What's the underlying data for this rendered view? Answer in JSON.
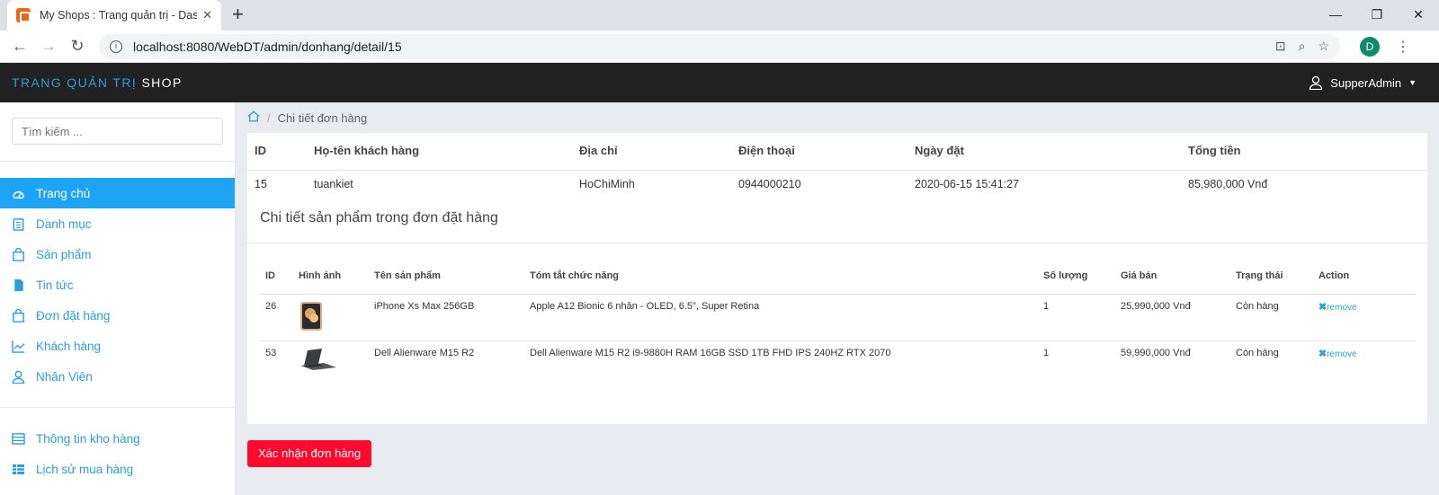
{
  "browser": {
    "tab_title": "My Shops : Trang quản trị - Dashboard",
    "url": "localhost:8080/WebDT/admin/donhang/detail/15",
    "profile_initial": "D"
  },
  "navbar": {
    "brand_main": "TRANG QUẢN TRỊ",
    "brand_suffix": "SHOP",
    "user_name": "SupperAdmin"
  },
  "sidebar": {
    "search_placeholder": "Tìm kiếm ...",
    "items": [
      {
        "label": "Trang chủ",
        "icon": "dashboard-icon",
        "active": true
      },
      {
        "label": "Danh mục",
        "icon": "clipboard-icon"
      },
      {
        "label": "Sản phẩm",
        "icon": "shopping-bag-icon"
      },
      {
        "label": "Tin tức",
        "icon": "document-icon"
      },
      {
        "label": "Đơn đặt hàng",
        "icon": "shopping-bag-icon"
      },
      {
        "label": "Khách hàng",
        "icon": "line-chart-icon"
      },
      {
        "label": "Nhân Viên",
        "icon": "user-icon"
      }
    ],
    "extra_items": [
      {
        "label": "Thông tin kho hàng",
        "icon": "table-icon"
      },
      {
        "label": "Lịch sử mua hàng",
        "icon": "grid-icon"
      }
    ]
  },
  "breadcrumb": {
    "current": "Chi tiết đơn hàng"
  },
  "order": {
    "headers": [
      "ID",
      "Họ-tên khách hàng",
      "Địa chỉ",
      "Điện thoại",
      "Ngày đặt",
      "Tổng tiền"
    ],
    "row": [
      "15",
      "tuankiet",
      "HoChiMinh",
      "0944000210",
      "2020-06-15 15:41:27",
      "85,980,000 Vnđ"
    ]
  },
  "items_section": {
    "title": "Chi tiết sản phẩm trong đơn đặt hàng",
    "headers": [
      "ID",
      "Hình ảnh",
      "Tên sản phẩm",
      "Tóm tắt chức năng",
      "Số lượng",
      "Giá bán",
      "Trạng thái",
      "Action"
    ],
    "rows": [
      {
        "id": "26",
        "name": "iPhone Xs Max 256GB",
        "summary": "Apple A12 Bionic 6 nhân - OLED, 6.5\", Super Retina",
        "qty": "1",
        "price": "25,990,000 Vnđ",
        "status": "Còn hàng",
        "action": "remove",
        "image": "iphone-image"
      },
      {
        "id": "53",
        "name": "Dell Alienware M15 R2",
        "summary": "Dell Alienware M15 R2 i9-9880H RAM 16GB SSD 1TB FHD IPS 240HZ RTX 2070",
        "qty": "1",
        "price": "59,990,000 Vnđ",
        "status": "Còn hàng",
        "action": "remove",
        "image": "laptop-image"
      }
    ]
  },
  "confirm_button": "Xác nhận đơn hàng"
}
